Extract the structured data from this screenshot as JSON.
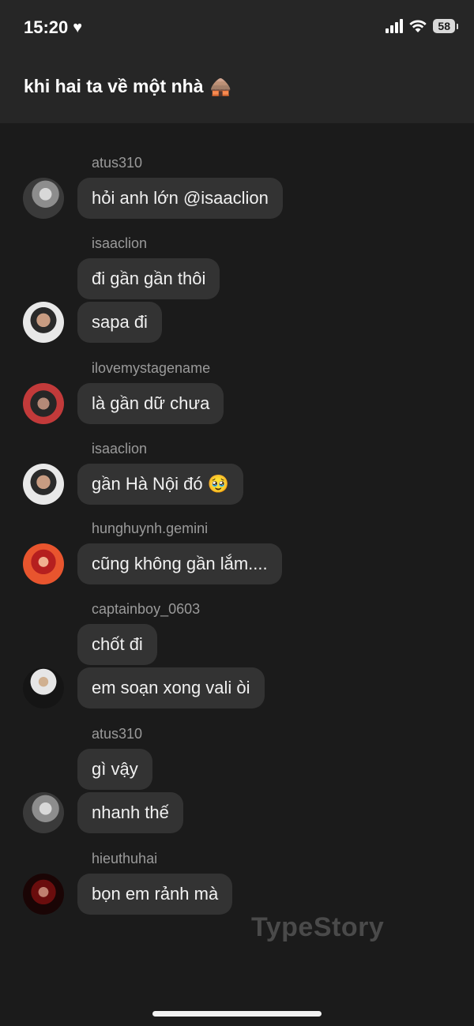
{
  "status_bar": {
    "time": "15:20",
    "battery": "58"
  },
  "chat": {
    "title": "khi hai ta về một nhà",
    "title_emoji": "🛖"
  },
  "messages": [
    {
      "sender": "atus310",
      "bubbles": [
        "hỏi anh lớn @isaaclion"
      ]
    },
    {
      "sender": "isaaclion",
      "bubbles": [
        "đi gần gần thôi",
        "sapa đi"
      ]
    },
    {
      "sender": "ilovemystagename",
      "bubbles": [
        "là gần dữ chưa"
      ]
    },
    {
      "sender": "isaaclion",
      "bubbles": [
        "gần Hà Nội đó 🥹"
      ]
    },
    {
      "sender": "hunghuynh.gemini",
      "bubbles": [
        "cũng không gần lắm...."
      ]
    },
    {
      "sender": "captainboy_0603",
      "bubbles": [
        "chốt đi",
        "em soạn xong vali òi"
      ]
    },
    {
      "sender": "atus310",
      "bubbles": [
        "gì vậy",
        "nhanh thế"
      ]
    },
    {
      "sender": "hieuthuhai",
      "bubbles": [
        "bọn em rảnh mà"
      ]
    }
  ],
  "watermark": "TypeStory",
  "colors": {
    "background": "#1b1b1b",
    "header": "#262626",
    "bubble": "#333333",
    "sender": "#9a9a9a"
  }
}
